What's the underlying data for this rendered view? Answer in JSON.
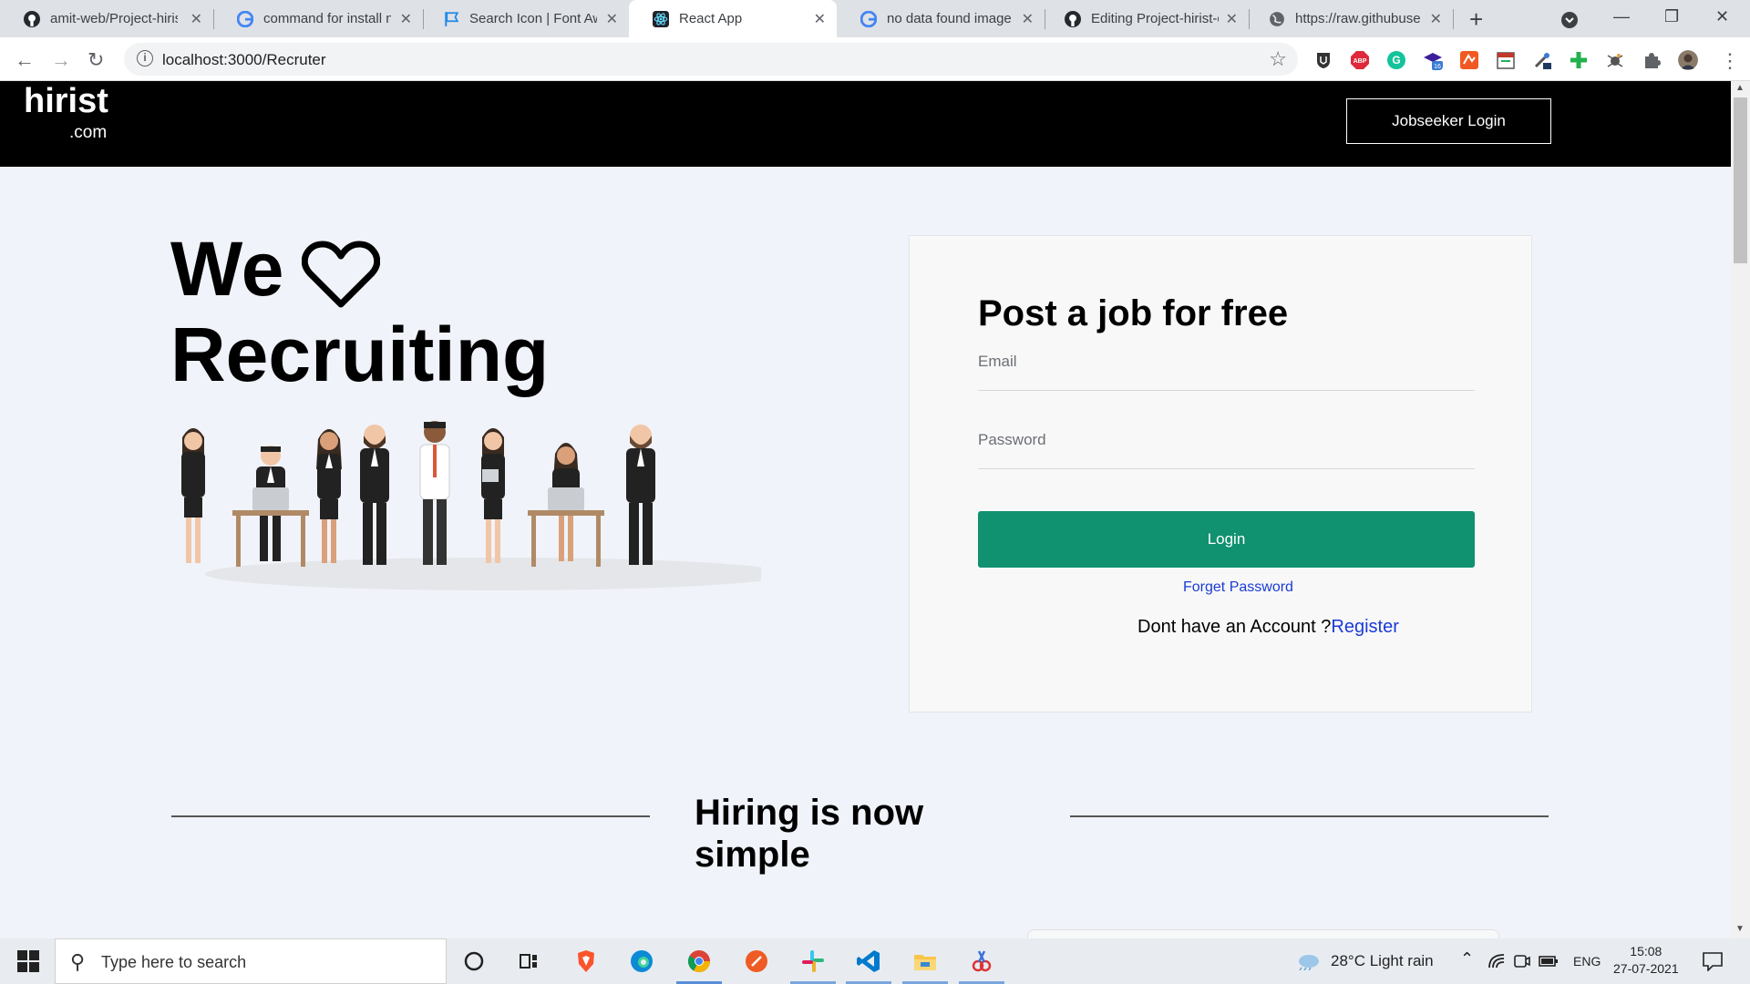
{
  "browser": {
    "tabs": [
      {
        "title": "amit-web/Project-hiris",
        "favicon": "github-icon"
      },
      {
        "title": "command for install n",
        "favicon": "google-icon"
      },
      {
        "title": "Search Icon | Font Aw",
        "favicon": "flag-icon"
      },
      {
        "title": "React App",
        "favicon": "react-icon",
        "active": true
      },
      {
        "title": "no data found image",
        "favicon": "google-icon"
      },
      {
        "title": "Editing Project-hirist-c",
        "favicon": "github-icon"
      },
      {
        "title": "https://raw.githubuse",
        "favicon": "globe-icon"
      }
    ],
    "url": "localhost:3000/Recruter",
    "new_tab": "+",
    "close_glyph": "✕"
  },
  "navbar": {
    "logo_main": "hirist",
    "logo_sub": ".com",
    "jobseeker_login": "Jobseeker Login"
  },
  "hero": {
    "line1": "We",
    "line2": "Recruiting",
    "heart_icon": "heart-outline-icon"
  },
  "login_card": {
    "title": "Post a job for free",
    "email_label": "Email",
    "password_label": "Password",
    "login_button": "Login",
    "forget_password": "Forget Password",
    "account_prompt": "Dont have an Account ?",
    "register_link": "Register"
  },
  "section": {
    "title_line1": "Hiring is now",
    "title_line2": "simple"
  },
  "taskbar": {
    "search_placeholder": "Type here to search",
    "weather": "28°C  Light rain",
    "language": "ENG",
    "time": "15:08",
    "date": "27-07-2021"
  },
  "colors": {
    "navbar_bg": "#000000",
    "login_button": "#10916f",
    "link": "#1a3bd6",
    "page_bg": "#f0f3f9"
  }
}
